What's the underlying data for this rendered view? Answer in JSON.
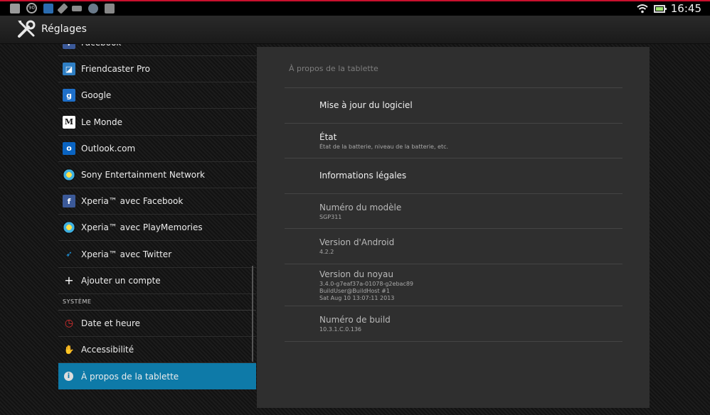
{
  "status_bar": {
    "icons": [
      "settings-icon",
      "timer-icon",
      "outlook-icon",
      "edit-icon",
      "usb-icon",
      "sensor-icon",
      "google-icon"
    ],
    "time": "16:45",
    "battery_level": 0.85
  },
  "action_bar": {
    "title": "Réglages"
  },
  "left_list": {
    "accounts": [
      {
        "label": "Facebook",
        "icon": "facebook-icon",
        "color": "#3b5998"
      },
      {
        "label": "Friendcaster Pro",
        "icon": "friendcaster-icon",
        "color": "#2f7fc4"
      },
      {
        "label": "Google",
        "icon": "google-icon",
        "color": "#1e6fc9"
      },
      {
        "label": "Le Monde",
        "icon": "lemonde-icon",
        "color": "#111111"
      },
      {
        "label": "Outlook.com",
        "icon": "outlook-icon",
        "color": "#0a64c2"
      },
      {
        "label": "Sony Entertainment Network",
        "icon": "sen-icon",
        "color": "#2fa3d6"
      },
      {
        "label": "Xperia™ avec Facebook",
        "icon": "facebook-icon",
        "color": "#3b5998"
      },
      {
        "label": "Xperia™ avec PlayMemories",
        "icon": "playmemories-icon",
        "color": "#2fa3d6"
      },
      {
        "label": "Xperia™ avec Twitter",
        "icon": "twitter-icon",
        "color": "#1da1f2"
      },
      {
        "label": "Ajouter un compte",
        "icon": "plus-icon",
        "color": "#000000"
      }
    ],
    "section_header": "SYSTÈME",
    "system": [
      {
        "label": "Date et heure",
        "icon": "clock-icon",
        "color": "#000000"
      },
      {
        "label": "Accessibilité",
        "icon": "hand-icon",
        "color": "#000000"
      },
      {
        "label": "À propos de la tablette",
        "icon": "info-icon",
        "color": "#000000",
        "selected": true
      }
    ]
  },
  "panel": {
    "title": "À propos de la tablette",
    "items": [
      {
        "title": "Mise à jour du logiciel",
        "sub": []
      },
      {
        "title": "État",
        "sub": [
          "État de la batterie, niveau de la batterie, etc."
        ]
      },
      {
        "title": "Informations légales",
        "sub": []
      },
      {
        "title": "Numéro du modèle",
        "sub": [
          "SGP311"
        ]
      },
      {
        "title": "Version d'Android",
        "sub": [
          "4.2.2"
        ]
      },
      {
        "title": "Version du noyau",
        "sub": [
          "3.4.0-g7eaf37a-01078-g2ebac89",
          "BuildUser@BuildHost #1",
          "Sat Aug 10 13:07:11 2013"
        ]
      },
      {
        "title": "Numéro de build",
        "sub": [
          "10.3.1.C.0.136"
        ]
      }
    ]
  },
  "colors": {
    "accent": "#0e7aa8",
    "status_bar_border": "#c8102e",
    "panel_bg": "#2f2f2f"
  }
}
